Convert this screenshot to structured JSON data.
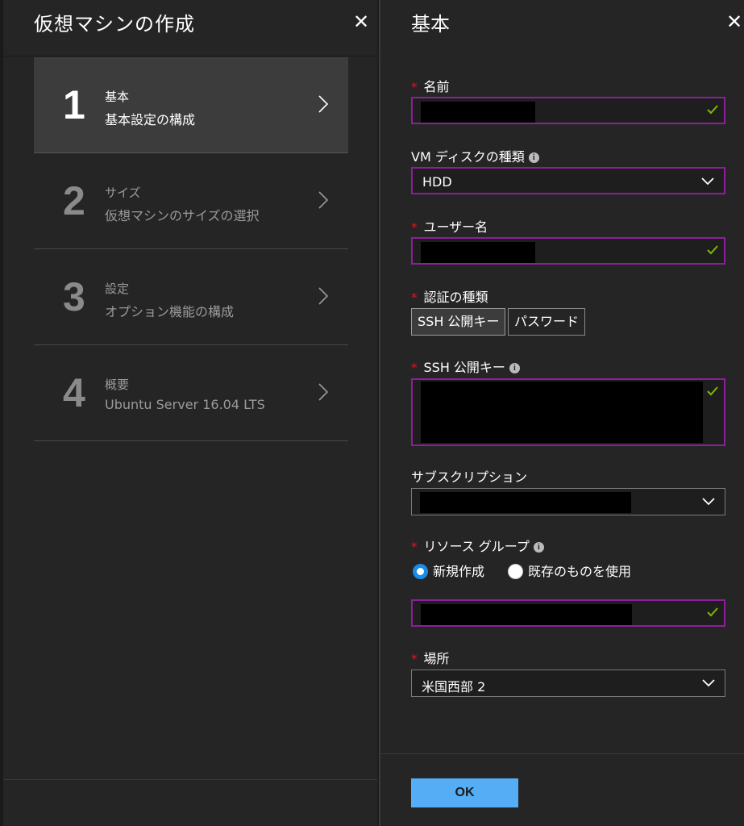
{
  "left": {
    "title": "仮想マシンの作成",
    "close_icon": "close-icon",
    "steps": [
      {
        "number": "1",
        "name": "基本",
        "desc": "基本設定の構成",
        "active": true
      },
      {
        "number": "2",
        "name": "サイズ",
        "desc": "仮想マシンのサイズの選択",
        "active": false
      },
      {
        "number": "3",
        "name": "設定",
        "desc": "オプション機能の構成",
        "active": false
      },
      {
        "number": "4",
        "name": "概要",
        "desc": "Ubuntu Server 16.04 LTS",
        "active": false
      }
    ]
  },
  "right": {
    "title": "基本",
    "close_icon": "close-icon",
    "fields": {
      "name_label": "名前",
      "disk_label": "VM ディスクの種類",
      "disk_value": "HDD",
      "username_label": "ユーザー名",
      "auth_label": "認証の種類",
      "auth_options": [
        "SSH 公開キー",
        "パスワード"
      ],
      "ssh_label": "SSH 公開キー",
      "subscription_label": "サブスクリプション",
      "rg_label": "リソース グループ",
      "rg_options": [
        "新規作成",
        "既存のものを使用"
      ],
      "location_label": "場所",
      "location_value": "米国西部 2"
    },
    "ok_label": "OK"
  },
  "colors": {
    "required": "#e81123",
    "valid_border": "#8f1e9c",
    "check": "#7fba00",
    "accent": "#55aef5",
    "radio": "#1b8be8"
  }
}
